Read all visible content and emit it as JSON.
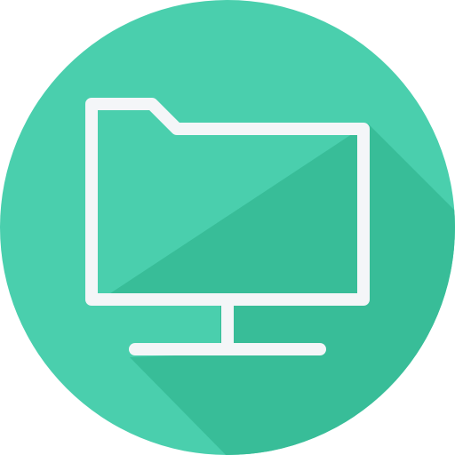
{
  "icon": {
    "name": "network-folder-icon",
    "colors": {
      "circle": "#4ACFAD",
      "long_shadow": "#38BD98",
      "line": "#F4F6F8"
    }
  }
}
